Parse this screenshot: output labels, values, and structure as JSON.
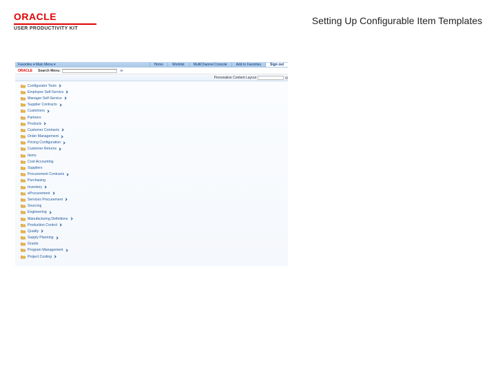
{
  "header": {
    "logo": "ORACLE",
    "logo_sub": "USER PRODUCTIVITY KIT",
    "title": "Setting Up Configurable Item Templates"
  },
  "topnav": {
    "left": "Favorites ▾   Main Menu ▾",
    "items": [
      "Home",
      "Worklist",
      "MultiChannel Console",
      "Add to Favorites",
      "Sign out"
    ]
  },
  "search": {
    "mini_logo": "ORACLE",
    "label": "Search Menu:",
    "adv": "≫"
  },
  "pc": {
    "label": "Personalize Content   Layout"
  },
  "menu": {
    "items": [
      {
        "label": "Configurator Tools",
        "arrow": true
      },
      {
        "label": "Employee Self-Service",
        "arrow": true
      },
      {
        "label": "Manager Self-Service",
        "arrow": true
      },
      {
        "label": "Supplier Contracts",
        "arrow": true
      },
      {
        "label": "Customers",
        "arrow": true
      },
      {
        "label": "Partners",
        "arrow": false
      },
      {
        "label": "Products",
        "arrow": true
      },
      {
        "label": "Customer Contracts",
        "arrow": true
      },
      {
        "label": "Order Management",
        "arrow": true
      },
      {
        "label": "Pricing Configuration",
        "arrow": true
      },
      {
        "label": "Customer Returns",
        "arrow": true
      },
      {
        "label": "Items",
        "arrow": false
      },
      {
        "label": "Cost Accounting",
        "arrow": false
      },
      {
        "label": "Suppliers",
        "arrow": false
      },
      {
        "label": "Procurement Contracts",
        "arrow": true
      },
      {
        "label": "Purchasing",
        "arrow": false
      },
      {
        "label": "Inventory",
        "arrow": true
      },
      {
        "label": "eProcurement",
        "arrow": true
      },
      {
        "label": "Services Procurement",
        "arrow": true
      },
      {
        "label": "Sourcing",
        "arrow": false
      },
      {
        "label": "Engineering",
        "arrow": true
      },
      {
        "label": "Manufacturing Definitions",
        "arrow": true
      },
      {
        "label": "Production Control",
        "arrow": true
      },
      {
        "label": "Quality",
        "arrow": true
      },
      {
        "label": "Supply Planning",
        "arrow": true
      },
      {
        "label": "Grants",
        "arrow": false
      },
      {
        "label": "Program Management",
        "arrow": true
      },
      {
        "label": "Project Costing",
        "arrow": true
      }
    ]
  },
  "colors": {
    "brand": "#e10000",
    "link": "#245a9a"
  }
}
